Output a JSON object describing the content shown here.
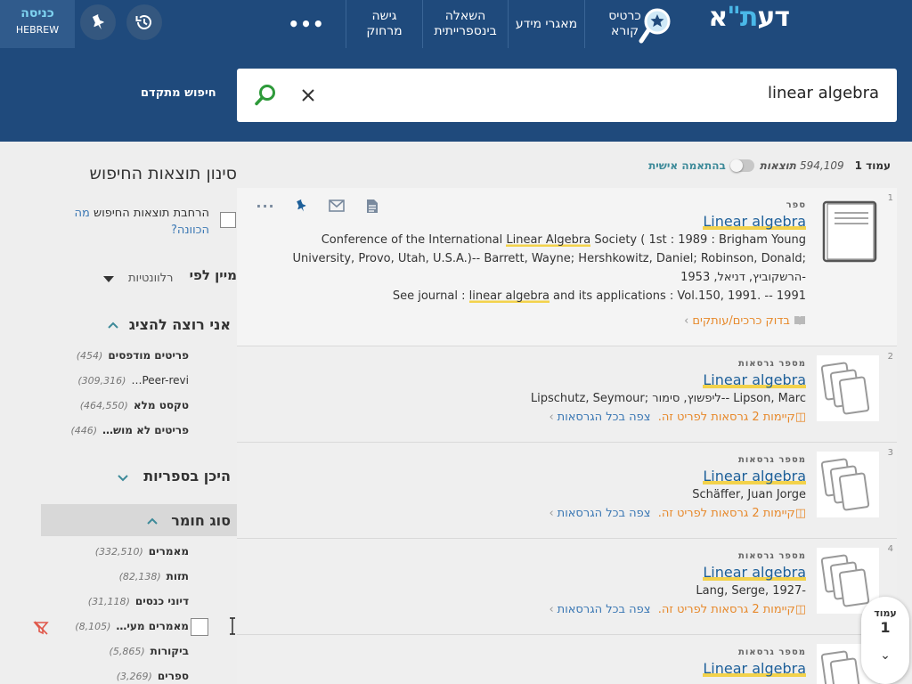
{
  "brand": {
    "logo": "דעת\"א"
  },
  "nav": {
    "items": [
      {
        "line1": "כרטיס",
        "line2": "קורא"
      },
      {
        "line1": "מאגרי מידע",
        "line2": ""
      },
      {
        "line1": "השאלה",
        "line2": "בינספרייתית"
      },
      {
        "line1": "גישה",
        "line2": "מרחוק"
      }
    ],
    "more": "•••"
  },
  "login": {
    "label": "כניסה",
    "language": "HEBREW"
  },
  "search": {
    "value": "linear algebra",
    "advanced_label": "חיפוש מתקדם"
  },
  "results_bar": {
    "page_label": "עמוד",
    "page_number": "1",
    "count": "594,109",
    "count_label": "תוצאות",
    "personal_label": "בהתאמה אישית",
    "personalization_on": false
  },
  "results": [
    {
      "num": "1",
      "type": "ספר",
      "title": "Linear algebra",
      "line1_pre": "Conference of the International ",
      "line1_hl": "Linear Algebra",
      "line1_post": " Society ( 1st : 1989 : Brigham Young",
      "line2": "University, Provo, Utah, U.S.A.)-- Barrett, Wayne; Hershkowitz, Daniel; Robinson, Donald;",
      "line3": "-הרשקוביץ, דניאל, 1953",
      "line4_pre": "See journal : ",
      "line4_hl": "linear algebra",
      "line4_post": " and its applications : Vol.150, 1991. -- 1991",
      "link": "בדוק כרכים/עותקים"
    },
    {
      "num": "2",
      "type": "מספר גרסאות",
      "title": "Linear algebra",
      "author": "Lipschutz, Seymour; ליפשוץ, סימור-- Lipson, Marc",
      "versions": "קיימות 2 גרסאות לפריט זה.",
      "view_all": "צפה בכל הגרסאות"
    },
    {
      "num": "3",
      "type": "מספר גרסאות",
      "title": "Linear algebra",
      "author": "Schäffer, Juan Jorge",
      "versions": "קיימות 2 גרסאות לפריט זה.",
      "view_all": "צפה בכל הגרסאות"
    },
    {
      "num": "4",
      "type": "מספר גרסאות",
      "title": "Linear algebra",
      "author": "Lang, Serge, 1927-",
      "versions": "קיימות 2 גרסאות לפריט זה.",
      "view_all": "צפה בכל הגרסאות"
    },
    {
      "num": "",
      "type": "מספר גרסאות",
      "title": "Linear algebra"
    }
  ],
  "facets": {
    "title": "סינון תוצאות החיפוש",
    "expand_label": "הרחבת תוצאות החיפוש",
    "expand_help": "מה הכוונה?",
    "sort_label": "מיין לפי",
    "sort_value": "רלוונטיות",
    "show_section": {
      "title": "אני רוצה להציג",
      "items": [
        {
          "name": "פריטים מודפסים",
          "count": "(454)"
        },
        {
          "name": "Peer-revi…",
          "count": "(309,316)"
        },
        {
          "name": "טקסט מלא",
          "count": "(464,550)"
        },
        {
          "name": "פריטים לא מוש…",
          "count": "(446)"
        }
      ]
    },
    "library_section": {
      "title": "היכן בספריות"
    },
    "material_section": {
      "title": "סוג חומר",
      "items": [
        {
          "name": "מאמרים",
          "count": "(332,510)"
        },
        {
          "name": "תזות",
          "count": "(82,138)"
        },
        {
          "name": "דיוני כנסים",
          "count": "(31,118)"
        },
        {
          "name": "מאמרים מעי…",
          "count": "(8,105)"
        },
        {
          "name": "ביקורות",
          "count": "(5,865)"
        },
        {
          "name": "ספרים",
          "count": "(3,269)"
        }
      ]
    }
  },
  "pager": {
    "label": "עמוד",
    "number": "1"
  },
  "colors": {
    "header": "#1f4a7c",
    "title_link": "#1d5f99",
    "highlight": "#f3d24b",
    "availability": "#e7892b",
    "search_icon": "#2e9a3a"
  }
}
